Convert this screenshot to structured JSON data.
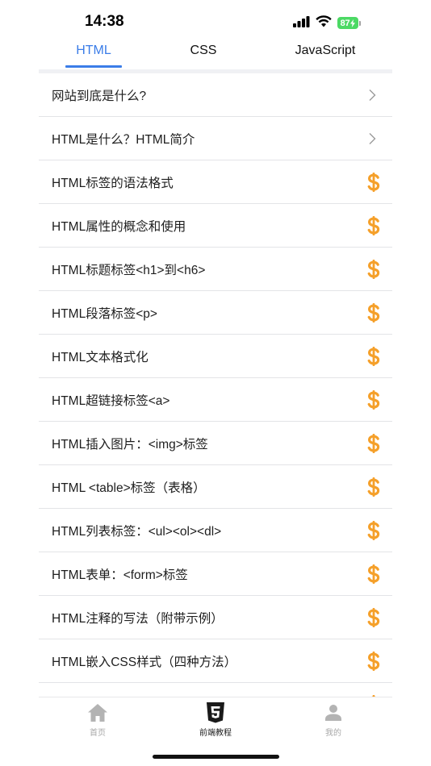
{
  "status_bar": {
    "time": "14:38",
    "battery": "87"
  },
  "tabs": [
    {
      "label": "HTML",
      "active": true
    },
    {
      "label": "CSS",
      "active": false
    },
    {
      "label": "JavaScript",
      "active": false
    }
  ],
  "list": {
    "items": [
      {
        "label": "网站到底是什么?",
        "icon": "chevron-right-icon"
      },
      {
        "label": "HTML是什么？HTML简介",
        "icon": "chevron-right-icon"
      },
      {
        "label": "HTML标签的语法格式",
        "icon": "dollar-icon"
      },
      {
        "label": "HTML属性的概念和使用",
        "icon": "dollar-icon"
      },
      {
        "label": "HTML标题标签<h1>到<h6>",
        "icon": "dollar-icon"
      },
      {
        "label": "HTML段落标签<p>",
        "icon": "dollar-icon"
      },
      {
        "label": "HTML文本格式化",
        "icon": "dollar-icon"
      },
      {
        "label": "HTML超链接标签<a>",
        "icon": "dollar-icon"
      },
      {
        "label": "HTML插入图片：<img>标签",
        "icon": "dollar-icon"
      },
      {
        "label": "HTML <table>标签（表格）",
        "icon": "dollar-icon"
      },
      {
        "label": "HTML列表标签：<ul><ol><dl>",
        "icon": "dollar-icon"
      },
      {
        "label": "HTML表单：<form>标签",
        "icon": "dollar-icon"
      },
      {
        "label": "HTML注释的写法（附带示例）",
        "icon": "dollar-icon"
      },
      {
        "label": "HTML嵌入CSS样式（四种方法）",
        "icon": "dollar-icon"
      },
      {
        "label": "",
        "icon": "dollar-icon"
      }
    ]
  },
  "bottom_nav": [
    {
      "label": "首页",
      "icon": "home-icon",
      "active": false
    },
    {
      "label": "前端教程",
      "icon": "html5-icon",
      "active": true
    },
    {
      "label": "我的",
      "icon": "user-icon",
      "active": false
    }
  ],
  "colors": {
    "accent": "#3b7de8",
    "dollar": "#f5a02a",
    "battery": "#4cd964"
  }
}
